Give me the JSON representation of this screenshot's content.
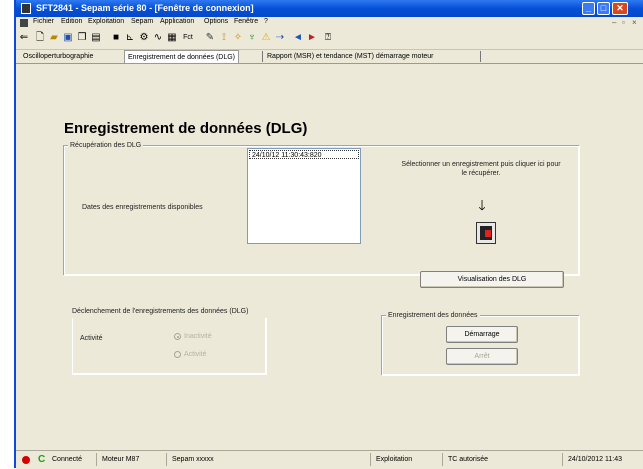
{
  "doc_id": "DE81221",
  "window": {
    "title": "SFT2841 - Sepam série 80 - [Fenêtre de connexion]"
  },
  "menu": {
    "items": [
      "Fichier",
      "Edition",
      "Exploitation",
      "Sepam",
      "Application",
      "Options",
      "Fenêtre",
      "?"
    ]
  },
  "toolbar": {
    "icons": [
      "back-icon",
      "new-icon",
      "open-icon",
      "save-icon",
      "copy-icon",
      "paste-icon",
      "sepam-icon",
      "logic-icon",
      "parameters-icon",
      "equation-icon",
      "events-icon",
      "fct-icon",
      "tool-icon",
      "test-icon",
      "wave-icon",
      "protection-icon",
      "alarm-icon",
      "disturbance-icon",
      "arrow-left-icon",
      "arrow-right-icon",
      "help-icon"
    ]
  },
  "tabs": [
    {
      "label": "Oscilloperturbographie"
    },
    {
      "label": "Enregistrement de données (DLG)"
    },
    {
      "label": "Rapport (MSR) et tendance (MST) démarrage moteur"
    }
  ],
  "page": {
    "title": "Enregistrement de données (DLG)"
  },
  "recovery": {
    "group_label": "Récupération des DLG",
    "dates_label": "Dates des enregistrements disponibles",
    "dates": [
      "24/10/12  11:30:43:820"
    ],
    "instruction": "Sélectionner un enregistrement puis cliquer ici pour le récupérer.",
    "view_button": "Visualisation des DLG"
  },
  "trigger": {
    "group_label": "Déclenchement de l'enregistrements des données (DLG)",
    "activity_label": "Activité",
    "options": [
      "Inactivité",
      "Activité"
    ]
  },
  "record": {
    "group_label": "Enregistrement des données",
    "start_button": "Démarrage",
    "stop_button": "Arrêt"
  },
  "status": {
    "connection": "Connecté",
    "model": "Moteur M87",
    "sepam": "Sepam xxxxx",
    "mode": "Exploitation",
    "remote": "TC autorisée",
    "datetime": "24/10/2012  11:43"
  }
}
